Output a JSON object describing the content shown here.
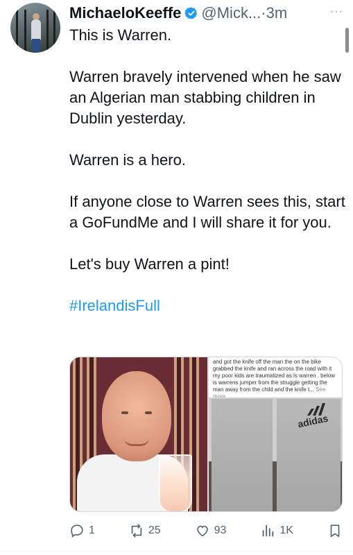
{
  "tweet": {
    "author_name": "MichaeloKeeffe",
    "handle": "@Mick...",
    "separator": "·",
    "time": "3m",
    "more_menu": "···",
    "paragraphs": [
      "This is Warren.",
      "Warren bravely intervened when he saw an Algerian man stabbing children in Dublin yesterday.",
      "Warren is a hero.",
      "If anyone close to Warren sees this, start a GoFundMe and I will share it for you.",
      "Let's buy Warren a pint!"
    ],
    "hashtag": "#IrelandisFull"
  },
  "media": {
    "comment_text": "and got the knife off the man the on the bike grabbed the knife and ran across the road with it my poor kids are traumatized as is warren . below is warrens jumper from the struggle getting the man away from the child and the knife t...",
    "comment_see_more": "See more",
    "jumper_logo_text": "adidas"
  },
  "actions": {
    "replies": "1",
    "reposts": "25",
    "likes": "93",
    "views": "1K"
  },
  "colors": {
    "link": "#1d9bf0",
    "verified": "#1d9bf0",
    "muted": "#536471"
  },
  "icons": {
    "verified": "verified-badge-icon",
    "reply": "reply-icon",
    "repost": "repost-icon",
    "like": "heart-icon",
    "views": "views-icon",
    "bookmark": "bookmark-icon"
  }
}
